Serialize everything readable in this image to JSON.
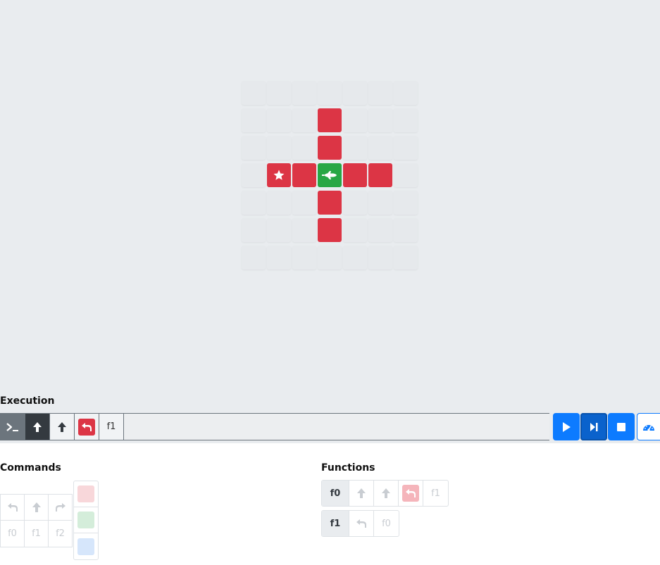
{
  "board": {
    "cols": 7,
    "rows": 7,
    "cells": [
      "e",
      "e",
      "e",
      "e",
      "e",
      "e",
      "e",
      "e",
      "e",
      "e",
      "red",
      "e",
      "e",
      "e",
      "e",
      "e",
      "e",
      "red",
      "e",
      "e",
      "e",
      "e",
      "red-star",
      "red",
      "green-ship",
      "red",
      "red",
      "e",
      "e",
      "e",
      "e",
      "red",
      "e",
      "e",
      "e",
      "e",
      "e",
      "e",
      "red",
      "e",
      "e",
      "e",
      "e",
      "e",
      "e",
      "e",
      "e",
      "e",
      "e"
    ],
    "colors": {
      "red": "#dc3545",
      "green": "#28a745",
      "empty": "#e6e9ec",
      "background": "#e9ecef"
    }
  },
  "execution": {
    "title": "Execution",
    "steps": [
      {
        "kind": "terminal-icon",
        "state": "done"
      },
      {
        "kind": "arrow-up-icon",
        "state": "current"
      },
      {
        "kind": "arrow-up-icon",
        "state": "pending"
      },
      {
        "kind": "turn-left-icon",
        "state": "pending",
        "color": "#dc3545"
      },
      {
        "kind": "text",
        "label": "f1",
        "state": "pending"
      }
    ],
    "controls": [
      {
        "name": "play-button",
        "icon": "play-icon"
      },
      {
        "name": "step-button",
        "icon": "step-forward-icon",
        "active": true
      },
      {
        "name": "stop-button",
        "icon": "stop-icon"
      },
      {
        "name": "speed-button",
        "icon": "speedometer-icon"
      }
    ]
  },
  "commands": {
    "title": "Commands",
    "row1": [
      "turn-left-icon",
      "arrow-up-icon",
      "turn-right-icon"
    ],
    "row2": [
      "f0",
      "f1",
      "f2"
    ],
    "colors": [
      "#f8d7da",
      "#d4edda",
      "#d6e6fb"
    ]
  },
  "functions": {
    "title": "Functions",
    "f0": {
      "label": "f0",
      "steps": [
        "arrow-up-icon",
        "arrow-up-icon",
        "turn-left-icon-red",
        "f1"
      ]
    },
    "f1": {
      "label": "f1",
      "steps": [
        "turn-left-icon",
        "f0"
      ]
    }
  }
}
